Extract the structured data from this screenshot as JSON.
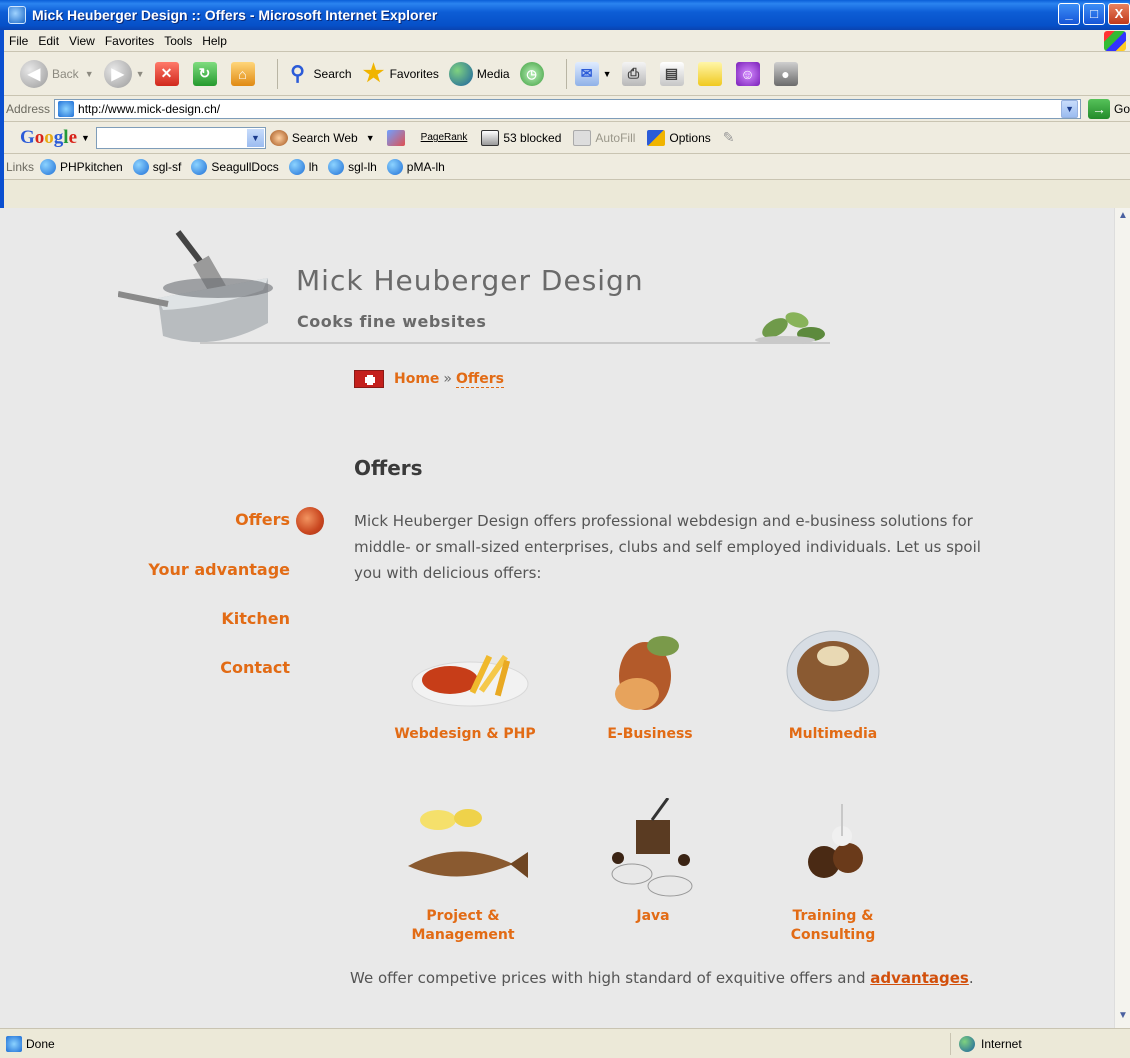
{
  "window": {
    "title": "Mick Heuberger Design :: Offers - Microsoft Internet Explorer",
    "buttons": {
      "minimize": "_",
      "maximize": "□",
      "close": "X"
    }
  },
  "menubar": [
    "File",
    "Edit",
    "View",
    "Favorites",
    "Tools",
    "Help"
  ],
  "toolbar": {
    "back": "Back",
    "search": "Search",
    "favorites": "Favorites",
    "media": "Media"
  },
  "address": {
    "label": "Address",
    "url": "http://www.mick-design.ch/",
    "go": "Go"
  },
  "googlebar": {
    "logo": [
      "G",
      "o",
      "o",
      "g",
      "l",
      "e"
    ],
    "search_web": "Search Web",
    "pagerank": "PageRank",
    "blocked": "53 blocked",
    "autofill": "AutoFill",
    "options": "Options"
  },
  "links": {
    "label": "Links",
    "items": [
      "PHPkitchen",
      "sgl-sf",
      "SeagullDocs",
      "lh",
      "sgl-lh",
      "pMA-lh"
    ]
  },
  "site": {
    "title": "Mick Heuberger Design",
    "tagline": "Cooks fine websites"
  },
  "breadcrumb": {
    "home": "Home",
    "separator": "»",
    "current": "Offers"
  },
  "nav": [
    "Offers",
    "Your advantage",
    "Kitchen",
    "Contact"
  ],
  "page": {
    "heading": "Offers",
    "intro": "Mick Heuberger Design offers professional webdesign and e-business solutions for middle- or small-sized enterprises, clubs and self employed individuals. Let us spoil you with delicious offers:",
    "offers": [
      {
        "label": "Webdesign & PHP",
        "icon": "sausage-fries-plate-image"
      },
      {
        "label": "E-Business",
        "icon": "roast-meat-image"
      },
      {
        "label": "Multimedia",
        "icon": "skewers-bowl-image"
      },
      {
        "label": "Project & Management",
        "icon": "fish-lemon-image"
      },
      {
        "label": "Java",
        "icon": "coffee-grinder-image"
      },
      {
        "label": "Training & Consulting",
        "icon": "chocolate-truffles-image"
      }
    ],
    "outro_text": "We offer competive prices with high standard of exquitive offers and ",
    "outro_link": "advantages",
    "outro_end": "."
  },
  "status": {
    "left": "Done",
    "zone": "Internet"
  },
  "colors": {
    "accent": "#e26b15",
    "page_bg": "#e9e9e9",
    "titlebar": "#0650c8"
  }
}
